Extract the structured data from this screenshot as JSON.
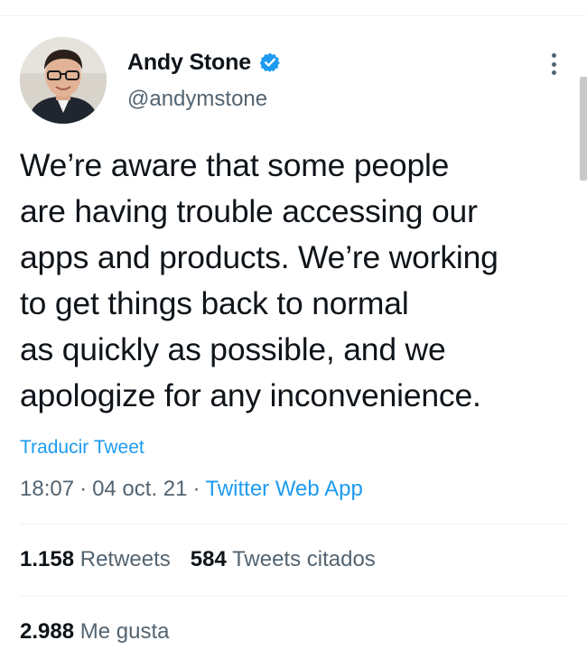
{
  "author": {
    "display_name": "Andy Stone",
    "handle": "@andymstone",
    "verified": true,
    "avatar_icon": "profile-photo"
  },
  "tweet": {
    "text": "We’re aware that some people\nare having trouble accessing our\napps and products. We’re working\nto get things back to normal\nas quickly as possible, and we\napologize for any inconvenience.",
    "translate_label": "Traducir Tweet",
    "time": "18:07",
    "date": "04 oct. 21",
    "separator": "·",
    "source": "Twitter Web App"
  },
  "stats": {
    "retweets_count": "1.158",
    "retweets_label": "Retweets",
    "quotes_count": "584",
    "quotes_label": "Tweets citados",
    "likes_count": "2.988",
    "likes_label": "Me gusta"
  },
  "colors": {
    "link": "#1d9bf0",
    "text": "#0f1419",
    "muted": "#536471",
    "divider": "#eff3f4"
  }
}
